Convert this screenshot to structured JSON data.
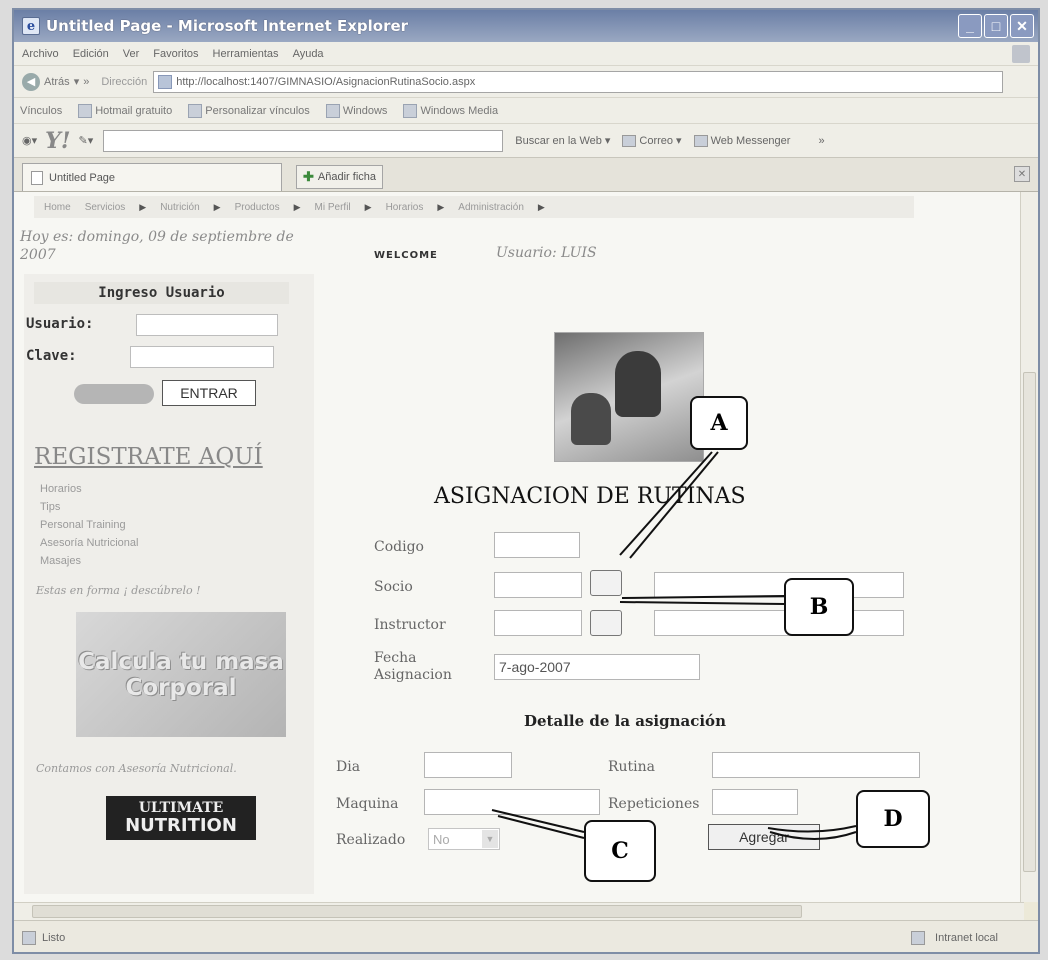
{
  "window": {
    "title": "Untitled Page - Microsoft Internet Explorer"
  },
  "menu": [
    "Archivo",
    "Edición",
    "Ver",
    "Favoritos",
    "Herramientas",
    "Ayuda"
  ],
  "address": {
    "back_label": "Atrás",
    "label": "Dirección",
    "url": "http://localhost:1407/GIMNASIO/AsignacionRutinaSocio.aspx"
  },
  "links": {
    "label": "Vínculos",
    "items": [
      "Hotmail gratuito",
      "Personalizar vínculos",
      "Windows",
      "Windows Media"
    ]
  },
  "yahoo_bar": {
    "logo": "Y!",
    "search_label": "Buscar en la Web",
    "mail_label": "Correo",
    "messenger_label": "Web Messenger"
  },
  "tabs": {
    "current": "Untitled Page",
    "new_tab_label": "Añadir ficha"
  },
  "nav": [
    "Home",
    "Servicios",
    "Nutrición",
    "Productos",
    "Mi Perfil",
    "Horarios",
    "Administración"
  ],
  "header": {
    "date": "Hoy es: domingo, 09 de septiembre de 2007",
    "welcome": "WELCOME",
    "user": "Usuario: LUIS"
  },
  "login": {
    "title": "Ingreso Usuario",
    "user_label": "Usuario:",
    "pass_label": "Clave:",
    "submit_label": "ENTRAR"
  },
  "sidebar": {
    "register_link": "REGISTRATE AQUÍ",
    "links": [
      "Horarios",
      "Tips",
      "Personal Training",
      "Asesoría Nutricional",
      "Masajes"
    ],
    "tagline": "Estas en forma ¡ descúbrelo !",
    "calc_banner": "Calcula tu masa Corporal",
    "nutrition_tagline": "Contamos con Asesoría Nutricional.",
    "ultimate_top": "ULTIMATE",
    "ultimate_bottom": "NUTRITION"
  },
  "form": {
    "title": "ASIGNACION DE RUTINAS",
    "codigo_label": "Codigo",
    "socio_label": "Socio",
    "instructor_label": "Instructor",
    "fecha_label": "Fecha Asignacion",
    "fecha_value": "7-ago-2007",
    "detalle_title": "Detalle de la asignación",
    "dia_label": "Dia",
    "rutina_label": "Rutina",
    "maquina_label": "Maquina",
    "repeticiones_label": "Repeticiones",
    "realizado_label": "Realizado",
    "realizado_value": "No",
    "agregar_label": "Agregar"
  },
  "callouts": [
    "A",
    "B",
    "C",
    "D"
  ],
  "status": {
    "left": "Listo",
    "zone": "Intranet local"
  }
}
